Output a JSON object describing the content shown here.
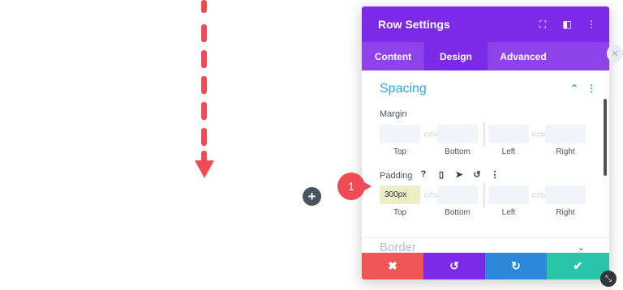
{
  "modal": {
    "title": "Row Settings",
    "header_icons": [
      "⛶",
      "◧",
      "⋮"
    ],
    "tabs": [
      {
        "label": "Content",
        "active": false
      },
      {
        "label": "Design",
        "active": true
      },
      {
        "label": "Advanced",
        "active": false
      }
    ]
  },
  "spacing": {
    "title": "Spacing",
    "collapse_glyph": "⌃",
    "menu_glyph": "⋮",
    "margin": {
      "label": "Margin",
      "top": {
        "label": "Top",
        "value": ""
      },
      "bottom": {
        "label": "Bottom",
        "value": ""
      },
      "left": {
        "label": "Left",
        "value": ""
      },
      "right": {
        "label": "Right",
        "value": ""
      }
    },
    "padding": {
      "label": "Padding",
      "icons": [
        "?",
        "▯",
        "➤",
        "↺",
        "⋮"
      ],
      "top": {
        "label": "Top",
        "value": "300px"
      },
      "bottom": {
        "label": "Bottom",
        "value": ""
      },
      "left": {
        "label": "Left",
        "value": ""
      },
      "right": {
        "label": "Right",
        "value": ""
      }
    },
    "link_glyph": "⊂/⊃"
  },
  "border": {
    "title": "Border",
    "chevron": "⌄"
  },
  "footer": {
    "discard": "✖",
    "undo": "↺",
    "redo": "↻",
    "save": "✔"
  },
  "canvas": {
    "add_row": "+",
    "callout_number": "1",
    "side_tab_glyph": "✕",
    "resize_glyph": "⤡"
  },
  "colors": {
    "accent_purple": "#7d2ae8",
    "tab_purple": "#8f42ec",
    "spacing_blue": "#2ea3f2",
    "discard_red": "#ef5555",
    "redo_blue": "#2b87da",
    "save_green": "#29c4a9",
    "arrow_red": "#ef4b55"
  }
}
